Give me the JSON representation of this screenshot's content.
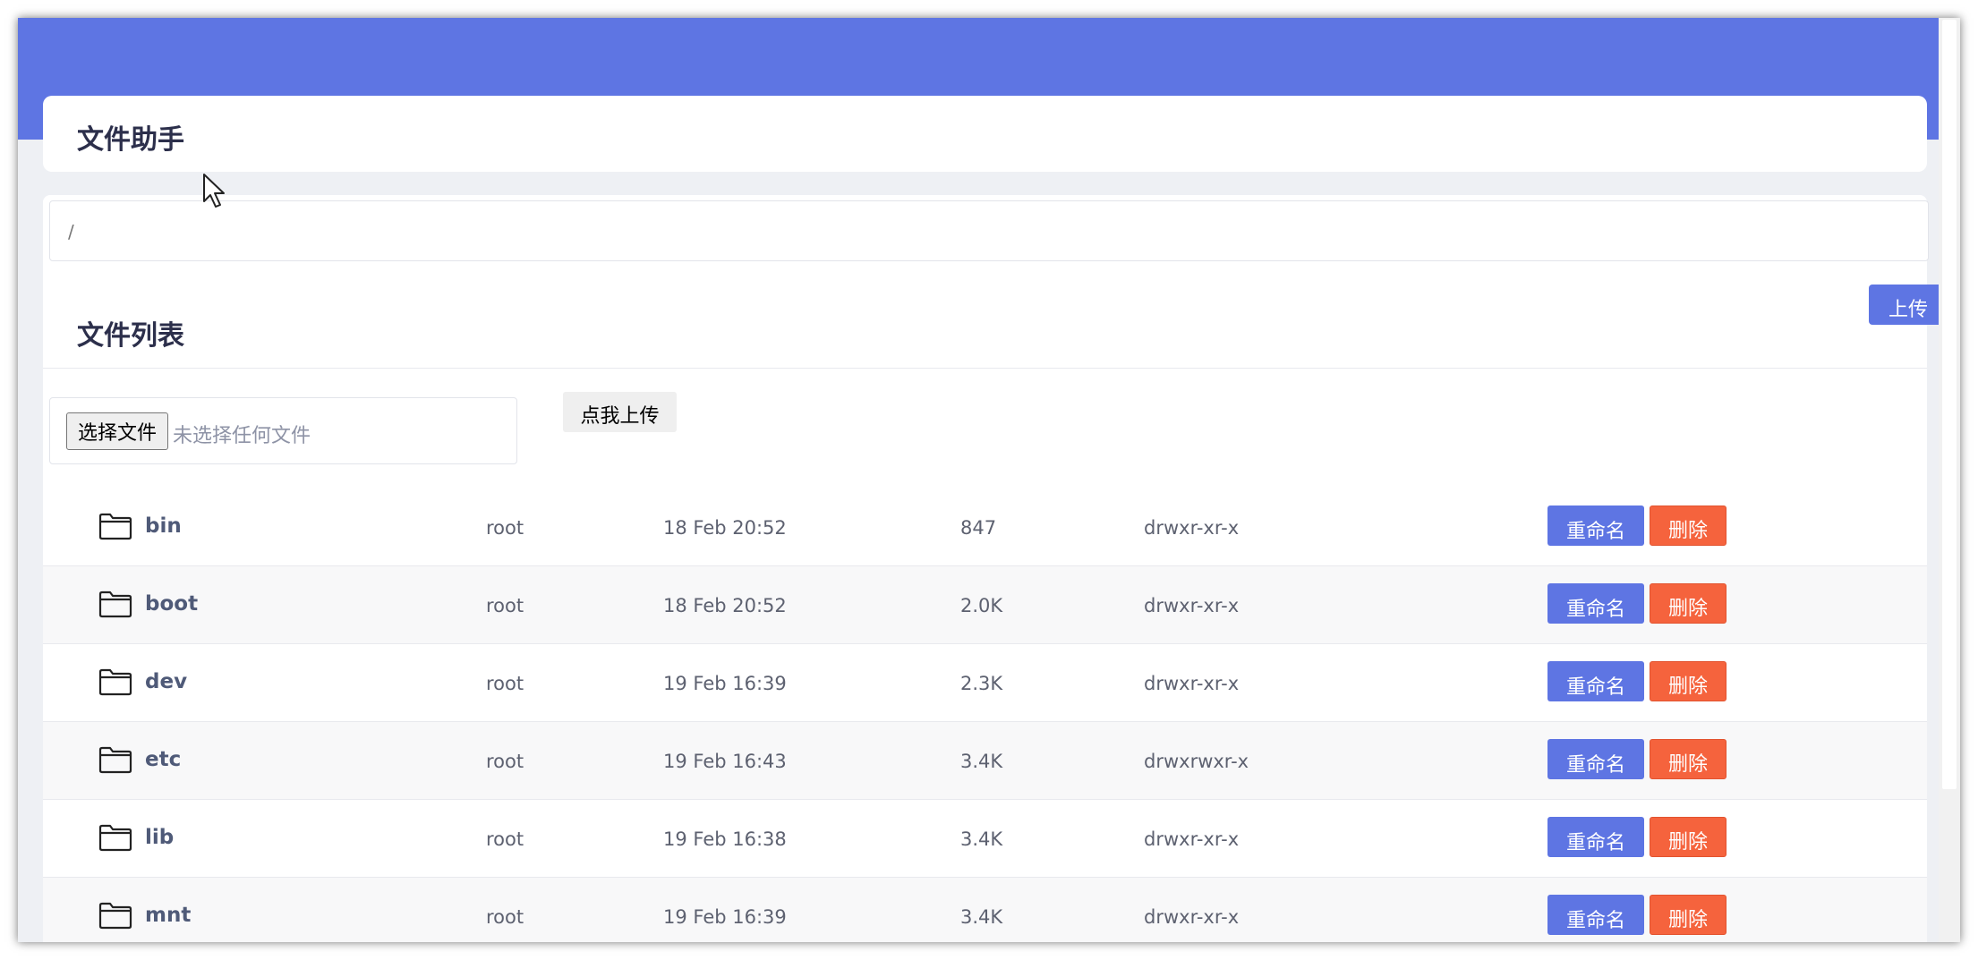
{
  "app": {
    "title": "文件助手"
  },
  "path": {
    "current": "/"
  },
  "file_list": {
    "title": "文件列表",
    "upload_button": "上传",
    "choose_file_button": "选择文件",
    "no_file_text": "未选择任何文件",
    "submit_upload_button": "点我上传"
  },
  "actions": {
    "rename_label": "重命名",
    "delete_label": "删除"
  },
  "files": [
    {
      "name": "bin",
      "owner": "root",
      "date": "18 Feb 20:52",
      "size": "847",
      "perm": "drwxr-xr-x",
      "icon": "folder-icon"
    },
    {
      "name": "boot",
      "owner": "root",
      "date": "18 Feb 20:52",
      "size": "2.0K",
      "perm": "drwxr-xr-x",
      "icon": "folder-icon"
    },
    {
      "name": "dev",
      "owner": "root",
      "date": "19 Feb 16:39",
      "size": "2.3K",
      "perm": "drwxr-xr-x",
      "icon": "folder-icon"
    },
    {
      "name": "etc",
      "owner": "root",
      "date": "19 Feb 16:43",
      "size": "3.4K",
      "perm": "drwxrwxr-x",
      "icon": "folder-icon"
    },
    {
      "name": "lib",
      "owner": "root",
      "date": "19 Feb 16:38",
      "size": "3.4K",
      "perm": "drwxr-xr-x",
      "icon": "folder-icon"
    },
    {
      "name": "mnt",
      "owner": "root",
      "date": "19 Feb 16:39",
      "size": "3.4K",
      "perm": "drwxr-xr-x",
      "icon": "folder-icon"
    }
  ],
  "colors": {
    "banner": "#5e75e3",
    "primary": "#5e75e3",
    "danger": "#f5633d"
  }
}
